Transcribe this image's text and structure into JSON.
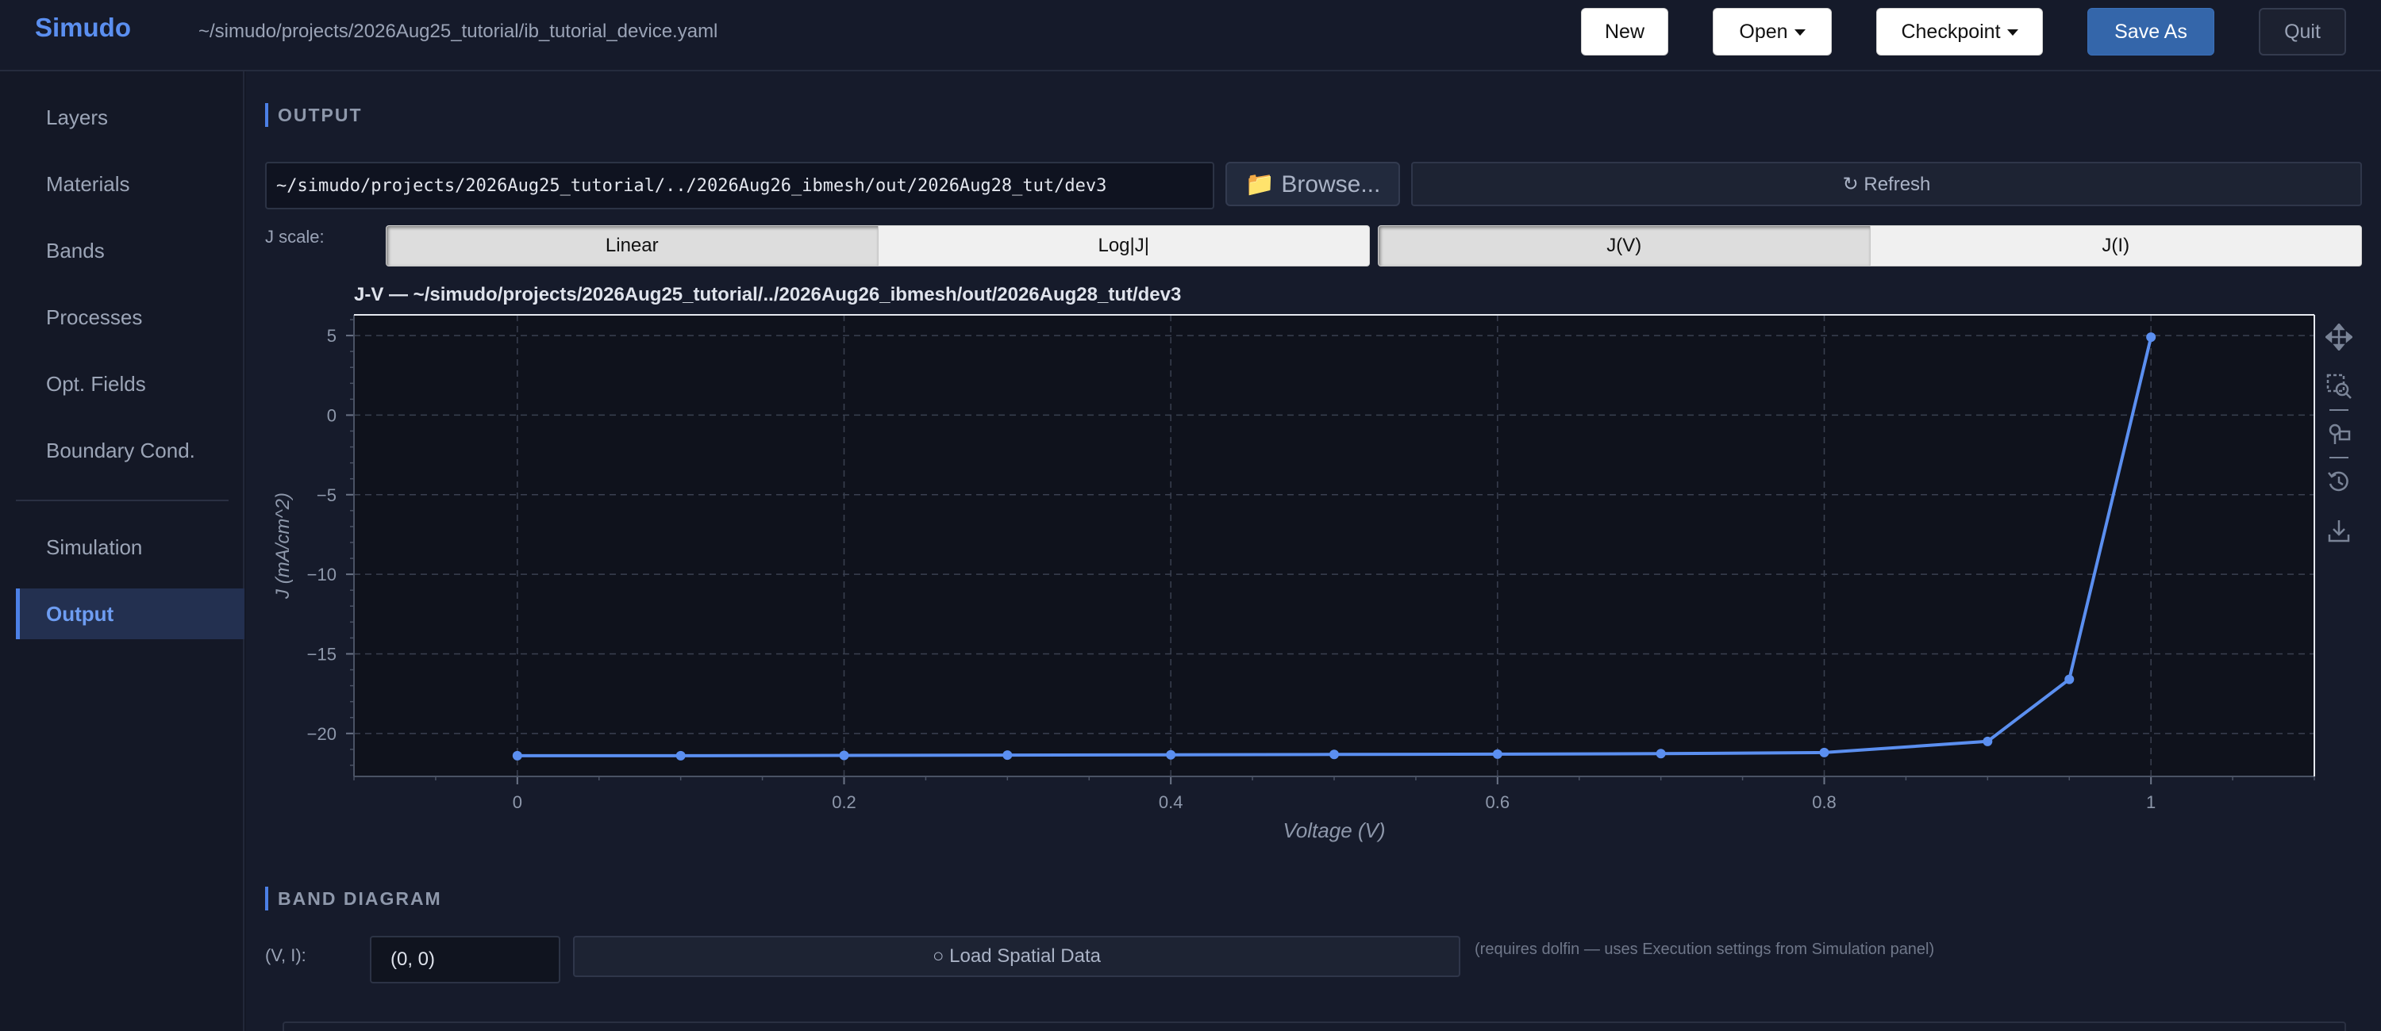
{
  "app": {
    "brand": "Simudo",
    "file_path": "~/simudo/projects/2026Aug25_tutorial/ib_tutorial_device.yaml"
  },
  "toolbar": {
    "new_label": "New",
    "open_label": "Open",
    "checkpoint_label": "Checkpoint",
    "save_as_label": "Save As",
    "quit_label": "Quit"
  },
  "sidebar": {
    "items": [
      {
        "label": "Layers"
      },
      {
        "label": "Materials"
      },
      {
        "label": "Bands"
      },
      {
        "label": "Processes"
      },
      {
        "label": "Opt. Fields"
      },
      {
        "label": "Boundary Cond."
      },
      {
        "label": "Simulation"
      },
      {
        "label": "Output"
      }
    ],
    "active": "Output"
  },
  "output": {
    "section_title": "OUTPUT",
    "path_value": "~/simudo/projects/2026Aug25_tutorial/../2026Aug26_ibmesh/out/2026Aug28_tut/dev3",
    "browse_label": "📁 Browse...",
    "refresh_label": "↻ Refresh",
    "jscale_label": "J scale:",
    "scale_options": [
      "Linear",
      "Log|J|"
    ],
    "scale_selected": "Linear",
    "mode_options": [
      "J(V)",
      "J(I)"
    ],
    "mode_selected": "J(V)",
    "chart_title": "J-V — ~/simudo/projects/2026Aug25_tutorial/../2026Aug26_ibmesh/out/2026Aug28_tut/dev3"
  },
  "chart_data": {
    "type": "line",
    "title": "J-V — ~/simudo/projects/2026Aug25_tutorial/../2026Aug26_ibmesh/out/2026Aug28_tut/dev3",
    "xlabel": "Voltage (V)",
    "ylabel": "J (mA/cm^2)",
    "xlim": [
      -0.1,
      1.1
    ],
    "ylim": [
      -22.7,
      6.3
    ],
    "xticks": [
      "0",
      "0.2",
      "0.4",
      "0.6",
      "0.8",
      "1"
    ],
    "yticks": [
      "5",
      "0",
      "−5",
      "−10",
      "−15",
      "−20"
    ],
    "grid": true,
    "series": [
      {
        "x": [
          0,
          0.1,
          0.2,
          0.3,
          0.4,
          0.5,
          0.6,
          0.7,
          0.8,
          0.9,
          0.95,
          1.0
        ],
        "y": [
          -21.4,
          -21.4,
          -21.38,
          -21.36,
          -21.34,
          -21.32,
          -21.3,
          -21.27,
          -21.2,
          -20.5,
          -16.6,
          4.9
        ],
        "color": "#5b8ff0"
      }
    ]
  },
  "plot_tools": [
    "pan-icon",
    "box-zoom-icon",
    "hover-icon",
    "reset-icon",
    "save-icon"
  ],
  "band_diagram": {
    "section_title": "BAND DIAGRAM",
    "vi_label": "(V, I):",
    "vi_value": "(0, 0)",
    "load_label": "○ Load Spatial Data",
    "hint": "(requires dolfin — uses Execution settings from Simulation panel)"
  },
  "colors": {
    "accent": "#4c80e6",
    "line": "#5b8ff0",
    "background": "#141826"
  }
}
